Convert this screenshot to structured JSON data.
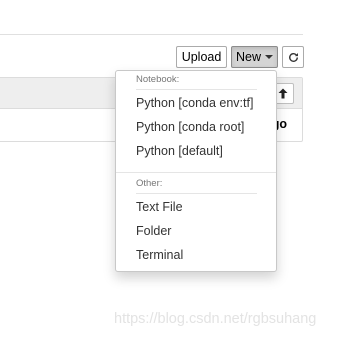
{
  "toolbar": {
    "upload_label": "Upload",
    "new_label": "New",
    "refresh_icon": "refresh-icon"
  },
  "file_list": {
    "sort_icon": "arrow-up-icon",
    "visible_row_text": "go"
  },
  "new_menu": {
    "notebook_header": "Notebook:",
    "kernels": [
      "Python [conda env:tf]",
      "Python [conda root]",
      "Python [default]"
    ],
    "other_header": "Other:",
    "other_items": [
      "Text File",
      "Folder",
      "Terminal"
    ]
  },
  "watermark": "https://blog.csdn.net/rgbsuhang"
}
